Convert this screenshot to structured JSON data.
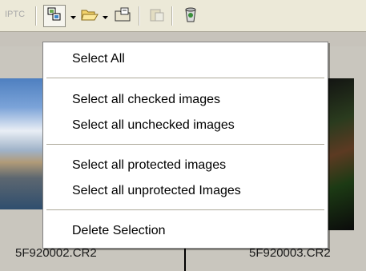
{
  "toolbar": {
    "iptc_label": "IPTC",
    "buttons": [
      {
        "name": "select-icon"
      },
      {
        "name": "open-folder-icon"
      },
      {
        "name": "copy-to-folder-icon"
      },
      {
        "name": "paste-icon"
      },
      {
        "name": "recycle-bin-icon"
      }
    ]
  },
  "menu": {
    "items": [
      {
        "label": "Select All"
      },
      {
        "label": "Select all checked images"
      },
      {
        "label": "Select all unchecked images"
      },
      {
        "label": "Select all protected images"
      },
      {
        "label": "Select all unprotected Images"
      },
      {
        "label": "Delete Selection"
      }
    ]
  },
  "thumbnails": [
    {
      "filename": "5F920002.CR2"
    },
    {
      "filename": "5F920003.CR2"
    }
  ]
}
